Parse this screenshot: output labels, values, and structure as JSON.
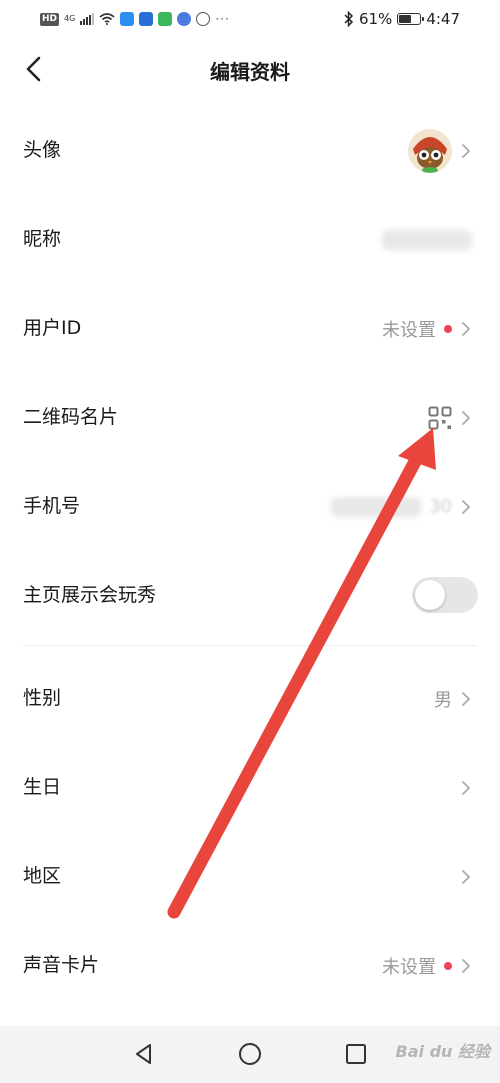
{
  "status_bar": {
    "badge": "HD",
    "network": "4G",
    "dots": "···",
    "battery_text": "61%",
    "battery_level": 0.61,
    "time": "4:47"
  },
  "header": {
    "title": "编辑资料"
  },
  "profile_rows": [
    {
      "label": "头像"
    },
    {
      "label": "昵称"
    },
    {
      "label": "用户ID",
      "value": "未设置"
    },
    {
      "label": "二维码名片"
    },
    {
      "label": "手机号",
      "value_partial": "30"
    },
    {
      "label": "主页展示会玩秀",
      "toggle_on": false
    },
    {
      "label": "性别",
      "value": "男"
    },
    {
      "label": "生日"
    },
    {
      "label": "地区"
    },
    {
      "label": "声音卡片",
      "value": "未设置"
    }
  ],
  "icons": {
    "back": "chevron-left-icon",
    "qr": "qr-code-icon",
    "chevron": "chevron-right-icon",
    "nav_back": "triangle-back-icon",
    "nav_home": "circle-home-icon",
    "nav_recent": "square-recent-icon"
  },
  "colors": {
    "accent_red_dot": "#f0405a",
    "annotation_arrow": "#e8453c",
    "toggle_off": "#e6e6e6",
    "nav_bar": "#f3f3f5"
  },
  "watermark": "Bai du 经验"
}
